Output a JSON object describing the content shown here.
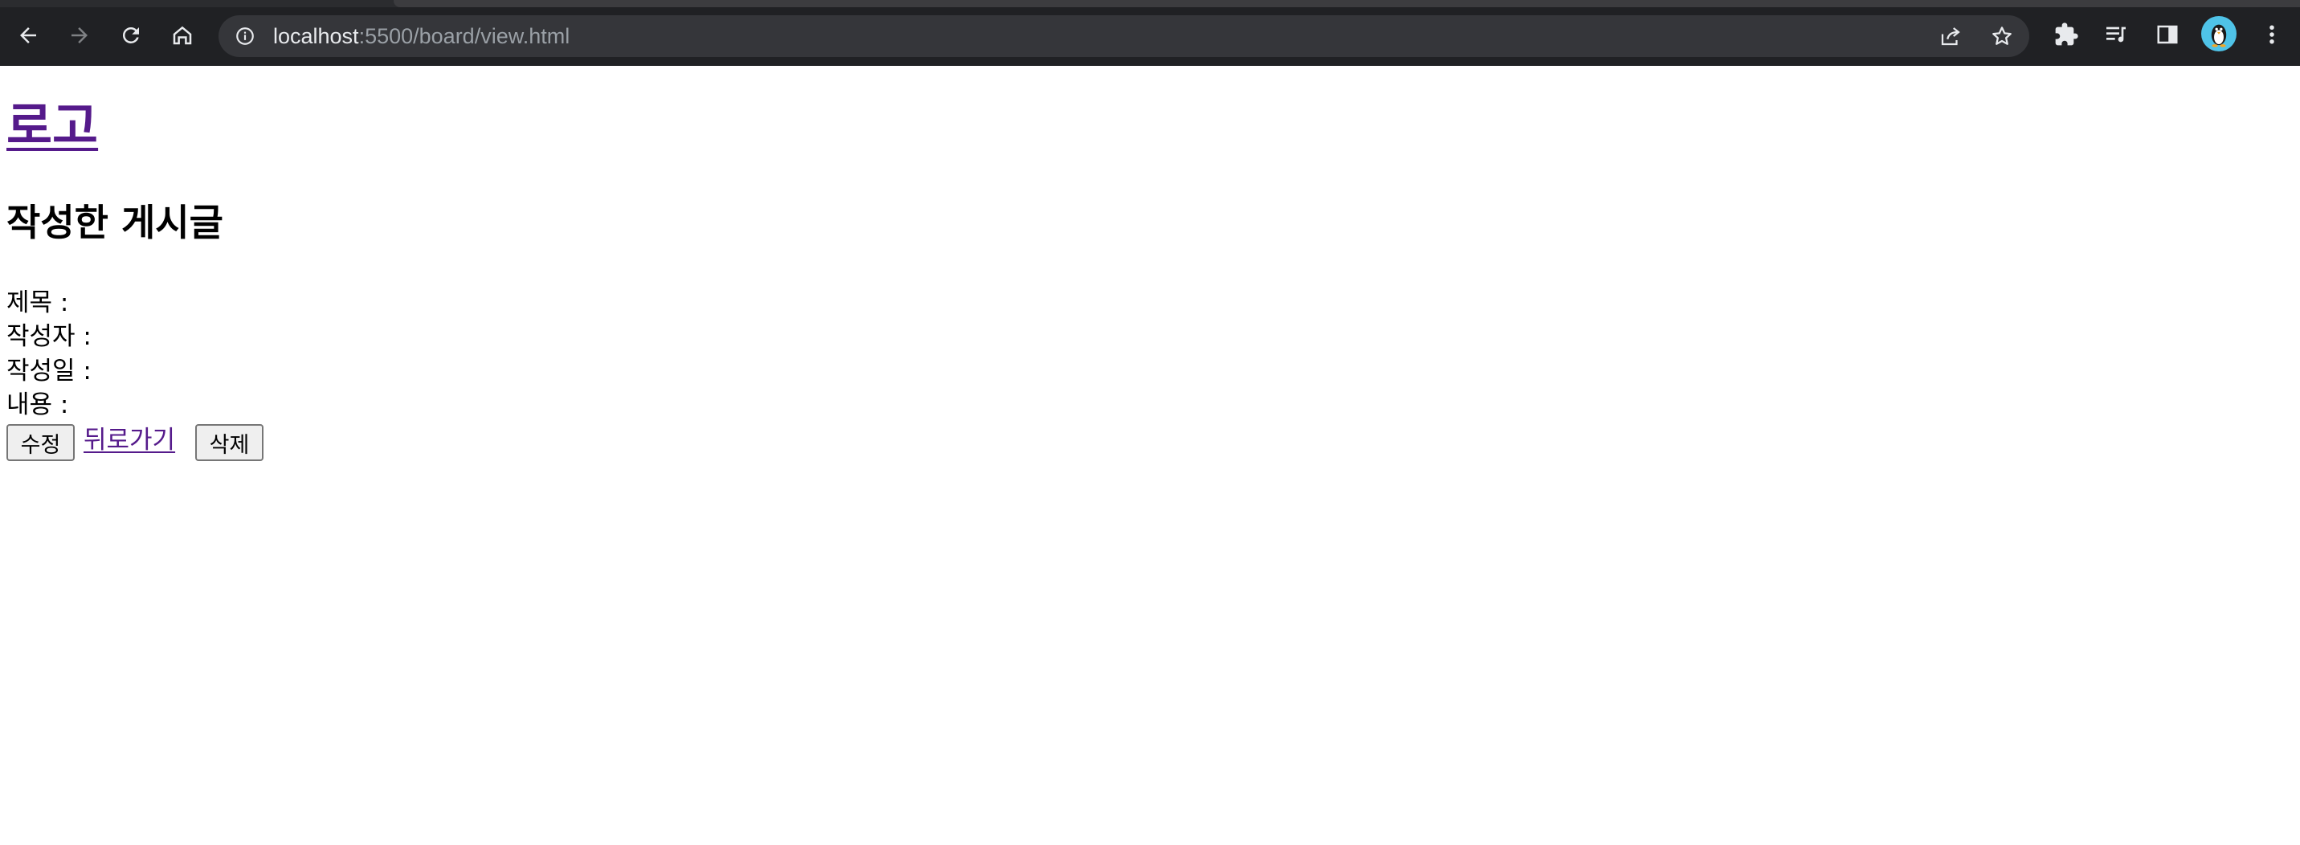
{
  "browser": {
    "url_host": "localhost",
    "url_rest": ":5500/board/view.html",
    "icons": {
      "back": "arrow-left-icon",
      "forward": "arrow-right-icon",
      "reload": "reload-icon",
      "home": "home-icon",
      "site_info": "info-icon",
      "share": "share-icon",
      "bookmark": "star-icon",
      "extensions": "puzzle-icon",
      "media": "media-queue-icon",
      "side_panel": "side-panel-icon",
      "profile": "penguin-avatar-icon",
      "menu": "kebab-menu-icon"
    },
    "colors": {
      "chrome_bg": "#202124",
      "omnibox_bg": "#35363a",
      "avatar_bg": "#4fc3e8"
    }
  },
  "page": {
    "logo_text": "로고",
    "title": "작성한 게시글",
    "fields": [
      {
        "label": "제목 :"
      },
      {
        "label": "작성자 :"
      },
      {
        "label": "작성일 :"
      },
      {
        "label": "내용 :"
      }
    ],
    "actions": {
      "edit_label": "수정",
      "back_label": "뒤로가기",
      "delete_label": "삭제"
    },
    "colors": {
      "visited_link": "#551a8b"
    }
  }
}
